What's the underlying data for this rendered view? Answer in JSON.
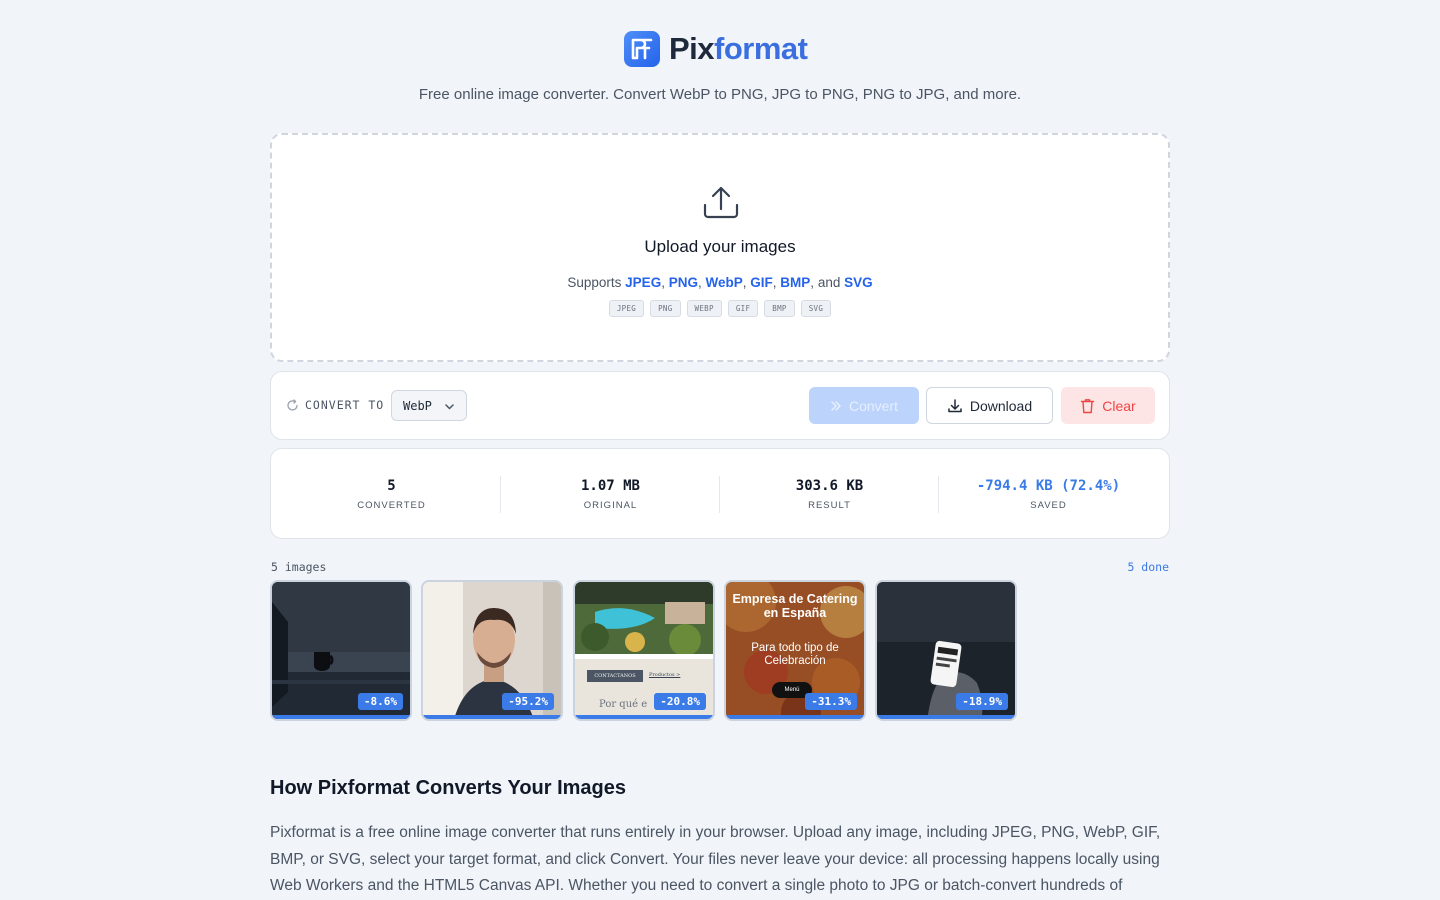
{
  "header": {
    "brand_pix": "Pix",
    "brand_format": "format",
    "tagline": "Free online image converter. Convert WebP to PNG, JPG to PNG, PNG to JPG, and more."
  },
  "upload": {
    "title": "Upload your images",
    "supports_prefix": "Supports",
    "formats": [
      "JPEG",
      "PNG",
      "WebP",
      "GIF",
      "BMP",
      "SVG"
    ],
    "and_text": "and",
    "chips": [
      "JPEG",
      "PNG",
      "WEBP",
      "GIF",
      "BMP",
      "SVG"
    ]
  },
  "toolbar": {
    "convert_to_label": "CONVERT TO",
    "selected_format": "WebP",
    "convert_label": "Convert",
    "download_label": "Download",
    "clear_label": "Clear"
  },
  "stats": [
    {
      "value": "5",
      "label": "CONVERTED"
    },
    {
      "value": "1.07 MB",
      "label": "ORIGINAL"
    },
    {
      "value": "303.6 KB",
      "label": "RESULT"
    },
    {
      "value": "-794.4 KB (72.4%)",
      "label": "SAVED"
    }
  ],
  "gallery": {
    "count_label": "5 images",
    "done_label": "5 done",
    "items": [
      {
        "badge": "-8.6%",
        "name": "dark desk with mug"
      },
      {
        "badge": "-95.2%",
        "name": "portrait of man"
      },
      {
        "badge": "-20.8%",
        "name": "garden pool website",
        "overlay_button": "CONTACTANOS",
        "overlay_link": "Productos >",
        "overlay_text": "Por qué e"
      },
      {
        "badge": "-31.3%",
        "name": "catering website",
        "overlay_title": "Empresa de Catering en España",
        "overlay_sub": "Para todo tipo de Celebración",
        "overlay_button": "Menú"
      },
      {
        "badge": "-18.9%",
        "name": "hand holding phone"
      }
    ]
  },
  "section": {
    "title": "How Pixformat Converts Your Images",
    "body": "Pixformat is a free online image converter that runs entirely in your browser. Upload any image, including JPEG, PNG, WebP, GIF, BMP, or SVG, select your target format, and click Convert. Your files never leave your device: all processing happens locally using Web Workers and the HTML5 Canvas API. Whether you need to convert a single photo to JPG or batch-convert hundreds of"
  },
  "colors": {
    "accent": "#3b7be8",
    "brand_blue": "#3b6fe0",
    "danger": "#ef4444",
    "background": "#f1f4f9"
  },
  "icons": {
    "logo": "pixformat-logo-icon",
    "upload": "upload-icon",
    "convert_to": "refresh-icon",
    "select": "chevron-down-icon",
    "convert": "double-chevron-right-icon",
    "download": "download-icon",
    "clear": "trash-icon"
  }
}
